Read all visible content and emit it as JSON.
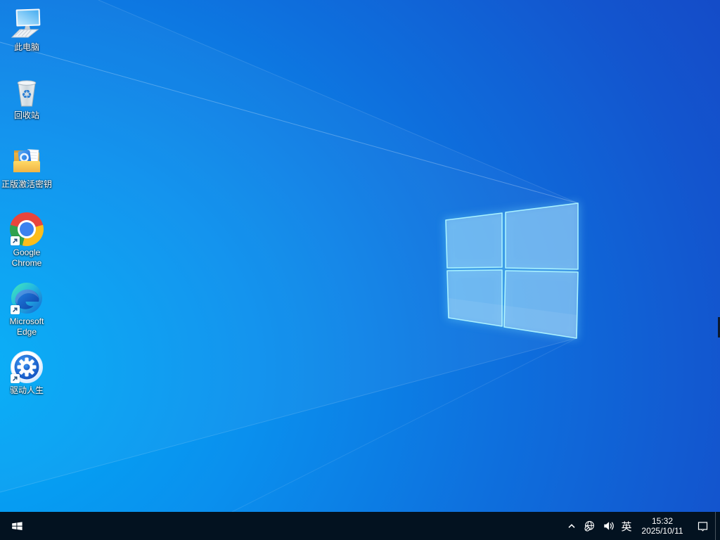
{
  "desktop": {
    "icons": [
      {
        "name": "this-pc",
        "lines": [
          "此电脑"
        ],
        "shortcut": false
      },
      {
        "name": "recycle-bin",
        "lines": [
          "回收站"
        ],
        "shortcut": false
      },
      {
        "name": "activation-key-folder",
        "lines": [
          "正版激活密钥"
        ],
        "shortcut": false
      },
      {
        "name": "google-chrome",
        "lines": [
          "Google",
          "Chrome"
        ],
        "shortcut": true
      },
      {
        "name": "microsoft-edge",
        "lines": [
          "Microsoft",
          "Edge"
        ],
        "shortcut": true
      },
      {
        "name": "driver-life",
        "lines": [
          "驱动人生"
        ],
        "shortcut": true
      }
    ],
    "wallpaper_watermark": "windows-10-glass-logo"
  },
  "taskbar": {
    "start_icon": "windows-flag-icon",
    "tray": {
      "ime_indicator": "英",
      "time": "15:32",
      "date": "2025/10/11",
      "icons": [
        "chevron-up-icon",
        "network-globe-no-internet-icon",
        "volume-icon",
        "action-center-icon"
      ]
    }
  },
  "colors": {
    "wallpaper_light": "#00aef7",
    "wallpaper_dark": "#1544c3",
    "logo_edge_glow": "#a9f2ff",
    "taskbar": "#031220",
    "chrome_red": "#e8453c",
    "chrome_yellow": "#fcbd1b",
    "chrome_green": "#30a24f",
    "chrome_blue": "#3b82ef",
    "folder_yellow": "#f6c14d",
    "label_text": "#ffffff"
  }
}
